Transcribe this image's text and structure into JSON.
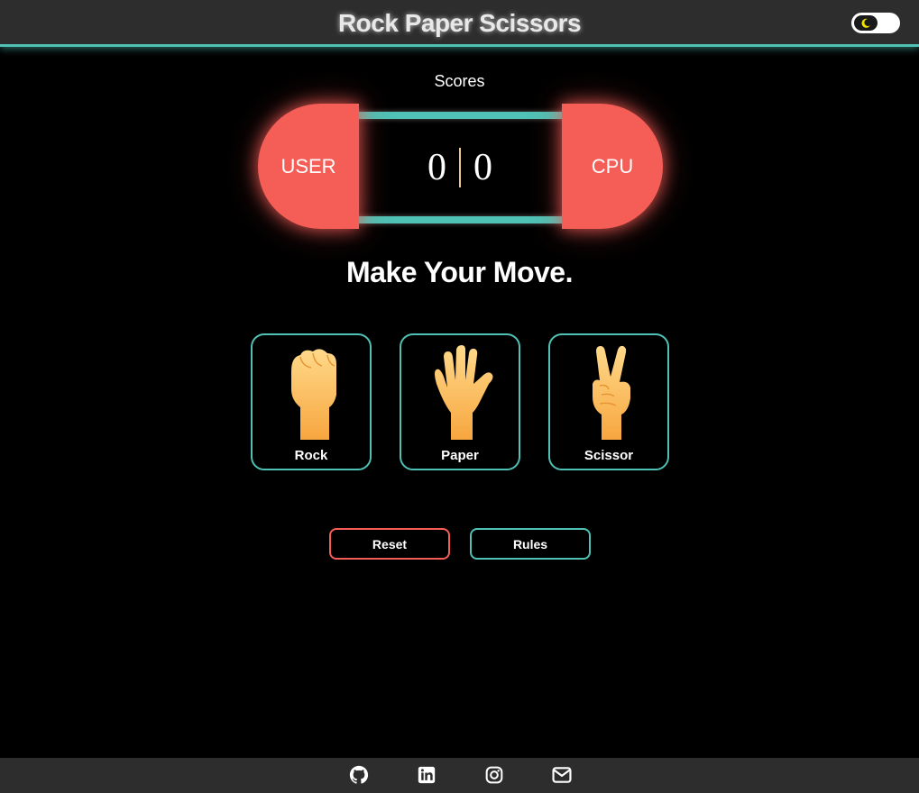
{
  "header": {
    "title": "Rock Paper Scissors",
    "theme_toggle_icon": "moon-icon"
  },
  "scores": {
    "label": "Scores",
    "user_label": "USER",
    "cpu_label": "CPU",
    "user_score": "0",
    "cpu_score": "0"
  },
  "headline": "Make Your Move.",
  "choices": [
    {
      "label": "Rock",
      "icon": "fist-icon"
    },
    {
      "label": "Paper",
      "icon": "open-hand-icon"
    },
    {
      "label": "Scissor",
      "icon": "victory-hand-icon"
    }
  ],
  "buttons": {
    "reset_label": "Reset",
    "rules_label": "Rules"
  },
  "footer": {
    "icons": [
      "github-icon",
      "linkedin-icon",
      "instagram-icon",
      "mail-icon"
    ]
  },
  "colors": {
    "accent_teal": "#4fc1b5",
    "accent_red": "#f55d57",
    "header_bg": "#2d2d2d",
    "background": "#000000",
    "hand": "#fbb35a"
  }
}
